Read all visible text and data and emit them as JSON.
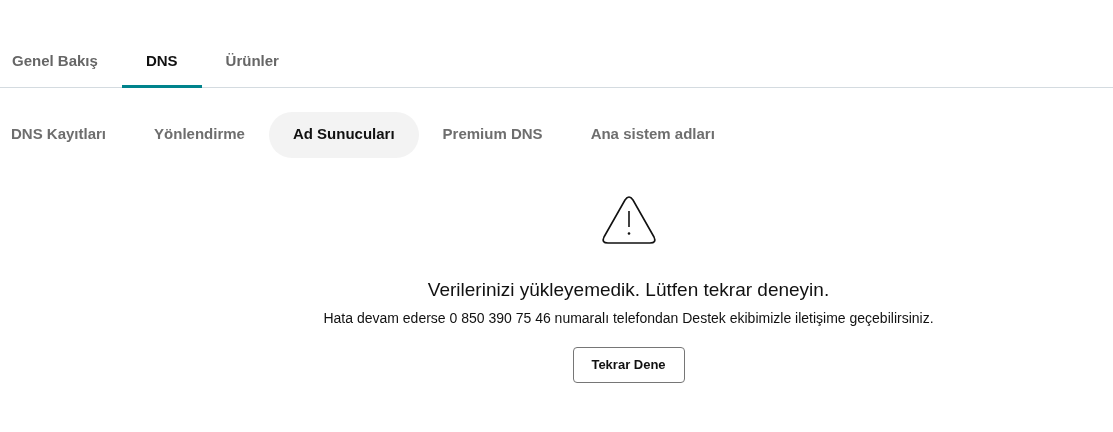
{
  "tabs": [
    {
      "label": "Genel Bakış",
      "selected": false
    },
    {
      "label": "DNS",
      "selected": true
    },
    {
      "label": "Ürünler",
      "selected": false
    }
  ],
  "subtabs": [
    {
      "label": "DNS Kayıtları",
      "selected": false
    },
    {
      "label": "Yönlendirme",
      "selected": false
    },
    {
      "label": "Ad Sunucuları",
      "selected": true
    },
    {
      "label": "Premium DNS",
      "selected": false
    },
    {
      "label": "Ana sistem adları",
      "selected": false
    }
  ],
  "error": {
    "title": "Verilerinizi yükleyemedik. Lütfen tekrar deneyin.",
    "message": "Hata devam ederse 0 850 390 75 46 numaralı telefondan Destek ekibimizle iletişime geçebilirsiniz.",
    "button": "Tekrar Dene"
  }
}
